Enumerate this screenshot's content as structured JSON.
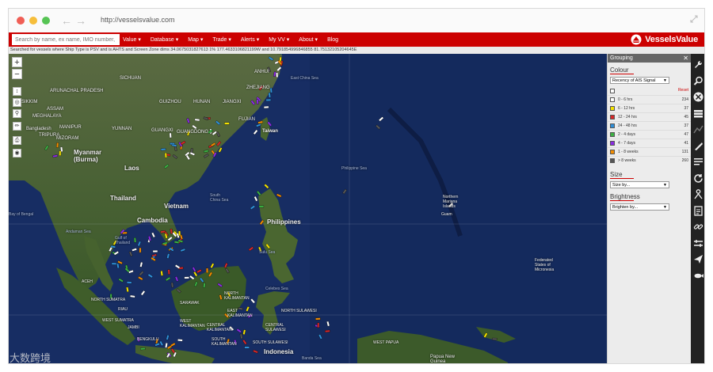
{
  "browser": {
    "url": "http://vesselsvalue.com"
  },
  "navbar": {
    "search_placeholder": "Search by name, ex name, IMO number, com",
    "menu": [
      "Value ▾",
      "Database ▾",
      "Map ▾",
      "Trade ▾",
      "Alerts ▾",
      "My VV ▾",
      "About ▾",
      "Blog"
    ],
    "brand": "VesselsValue",
    "brand_color": "#cc0000"
  },
  "status": {
    "text": "Searched for vessels where Ship Type is PSV and is AHTS and Screen Zone dims 34.0675031827613 1% 177.4633106821199W and 10.791854996846855 81.75132105204645E"
  },
  "map": {
    "controls": [
      "+",
      "−"
    ],
    "labels": {
      "sichuan": "SICHUAN",
      "anhui": "ANHUI",
      "zhejiang": "ZHEJIANG",
      "arunachal": "ARUNACHAL PRADESH",
      "xikim": "SIKKIM",
      "assam": "ASSAM",
      "meghalaya": "MEGHALAYA",
      "bangladesh": "Bangladesh",
      "tripura": "TRIPURA",
      "manipur": "MANIPUR",
      "mizoram": "MIZORAM",
      "guizhou": "GUIZHOU",
      "hunan": "HUNAN",
      "jiangxi": "JIANGXI",
      "fujian": "FUJIAN",
      "yunnan": "YUNNAN",
      "guangxi": "GUANGXI",
      "guangdong": "GUANGDONG",
      "taiwan": "Taiwan",
      "myanmar": "Myanmar\n(Burma)",
      "laos": "Laos",
      "thailand": "Thailand",
      "cambodia": "Cambodia",
      "vietnam": "Vietnam",
      "south_china_sea": "South\nChina Sea",
      "philippine_sea": "Philippine Sea",
      "philippines": "Philippines",
      "east_china_sea": "East China Sea",
      "northern_mariana": "Northern\nMariana\nIslands",
      "guam": "Guam",
      "bay_of_bengal": "Bay of Bengal",
      "andaman_sea": "Andaman Sea",
      "gulf_thailand": "Gulf of\nThailand",
      "sulu_sea": "Sulu Sea",
      "celebes_sea": "Celebes Sea",
      "aceh": "ACEH",
      "north_sumatra": "NORTH SUMATRA",
      "riau": "RIAU",
      "west_sumatra": "WEST SUMATRA",
      "jambi": "JAMBI",
      "bengkulu": "BENGKULU",
      "sarawak": "SARAWAK",
      "west_kalimantan": "WEST\nKALIMANTAN",
      "central_kalimantan": "CENTRAL\nKALIMANTAN",
      "south_kalimantan": "SOUTH\nKALIMANTAN",
      "north_kalimantan": "NORTH\nKALIMANTAN",
      "east_kalimantan": "EAST\nKALIMANTAN",
      "north_sulawesi": "NORTH SULAWESI",
      "central_sulawesi": "CENTRAL\nSULAWESI",
      "south_sulawesi": "SOUTH SULAWESI",
      "indonesia": "Indonesia",
      "banda_sea": "Banda Sea",
      "papua_new_guinea": "Papua New\nGuinea",
      "micronesia": "Federated\nStates of\nMicronesia",
      "west_papua": "WEST PAPUA"
    }
  },
  "panel": {
    "title": "Grouping",
    "colour_title": "Colour",
    "colour_select": "Recency of AIS Signal",
    "reset": "Reset",
    "legend": [
      {
        "label": "0 - 6 hrs",
        "count": "234",
        "color": "#ffffff"
      },
      {
        "label": "6 - 12 hrs",
        "count": "37",
        "color": "#f5e300"
      },
      {
        "label": "12 - 24 hrs",
        "count": "45",
        "color": "#d62828"
      },
      {
        "label": "24 - 48 hrs",
        "count": "37",
        "color": "#2f8fd8"
      },
      {
        "label": "2 - 4 days",
        "count": "47",
        "color": "#3cb043"
      },
      {
        "label": "4 - 7 days",
        "count": "41",
        "color": "#8a2be2"
      },
      {
        "label": "1 - 8 weeks",
        "count": "131",
        "color": "#f28c00"
      },
      {
        "label": "> 8 weeks",
        "count": "260",
        "color": "#555555"
      }
    ],
    "size_title": "Size",
    "size_select": "Size by...",
    "brightness_title": "Brightness",
    "brightness_select": "Brighten by..."
  },
  "toolbar": {
    "tools": [
      "wrench-icon",
      "search-icon",
      "filter-icon",
      "layers-icon",
      "route-icon",
      "vessel-icon",
      "list-icon",
      "refresh-icon",
      "person-icon",
      "document-icon",
      "link-icon",
      "ruler-icon",
      "plane-icon",
      "fish-icon"
    ]
  },
  "watermark": {
    "text": "大数跨境"
  }
}
